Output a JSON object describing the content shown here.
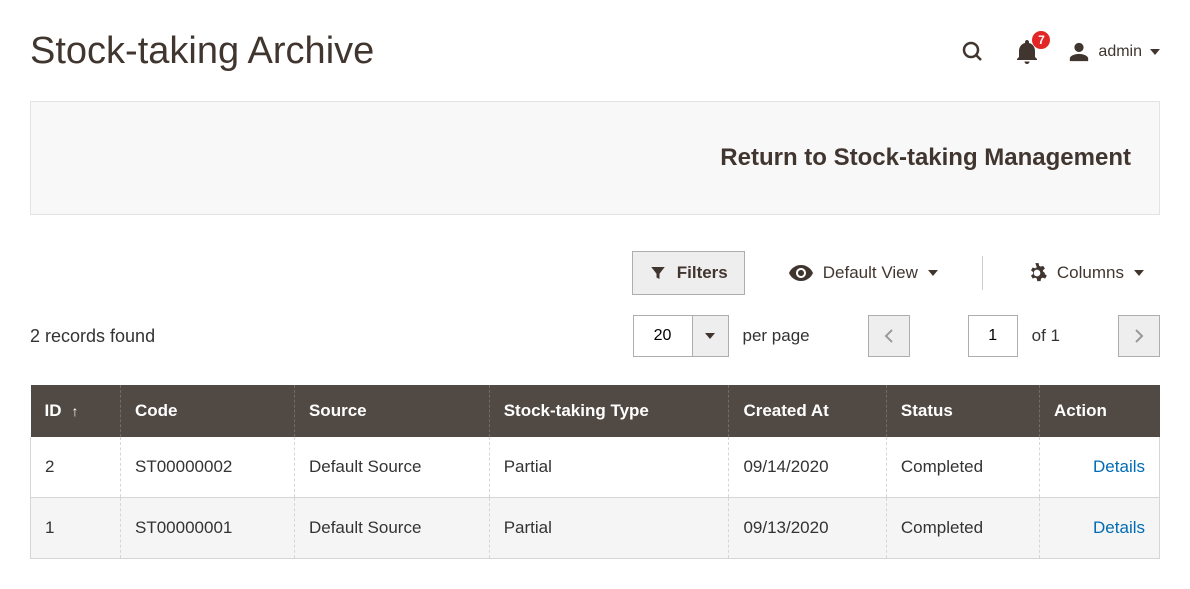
{
  "header": {
    "title": "Stock-taking Archive",
    "notification_count": "7",
    "username": "admin"
  },
  "return_bar": {
    "label": "Return to Stock-taking Management"
  },
  "toolbar": {
    "filters_label": "Filters",
    "view_label": "Default View",
    "columns_label": "Columns",
    "records_found": "2 records found",
    "per_page_value": "20",
    "per_page_label": "per page",
    "page_value": "1",
    "page_of": "of 1"
  },
  "grid": {
    "columns": {
      "id": "ID",
      "code": "Code",
      "source": "Source",
      "type": "Stock-taking Type",
      "created": "Created At",
      "status": "Status",
      "action": "Action"
    },
    "rows": [
      {
        "id": "2",
        "code": "ST00000002",
        "source": "Default Source",
        "type": "Partial",
        "created": "09/14/2020",
        "status": "Completed",
        "action": "Details"
      },
      {
        "id": "1",
        "code": "ST00000001",
        "source": "Default Source",
        "type": "Partial",
        "created": "09/13/2020",
        "status": "Completed",
        "action": "Details"
      }
    ]
  }
}
